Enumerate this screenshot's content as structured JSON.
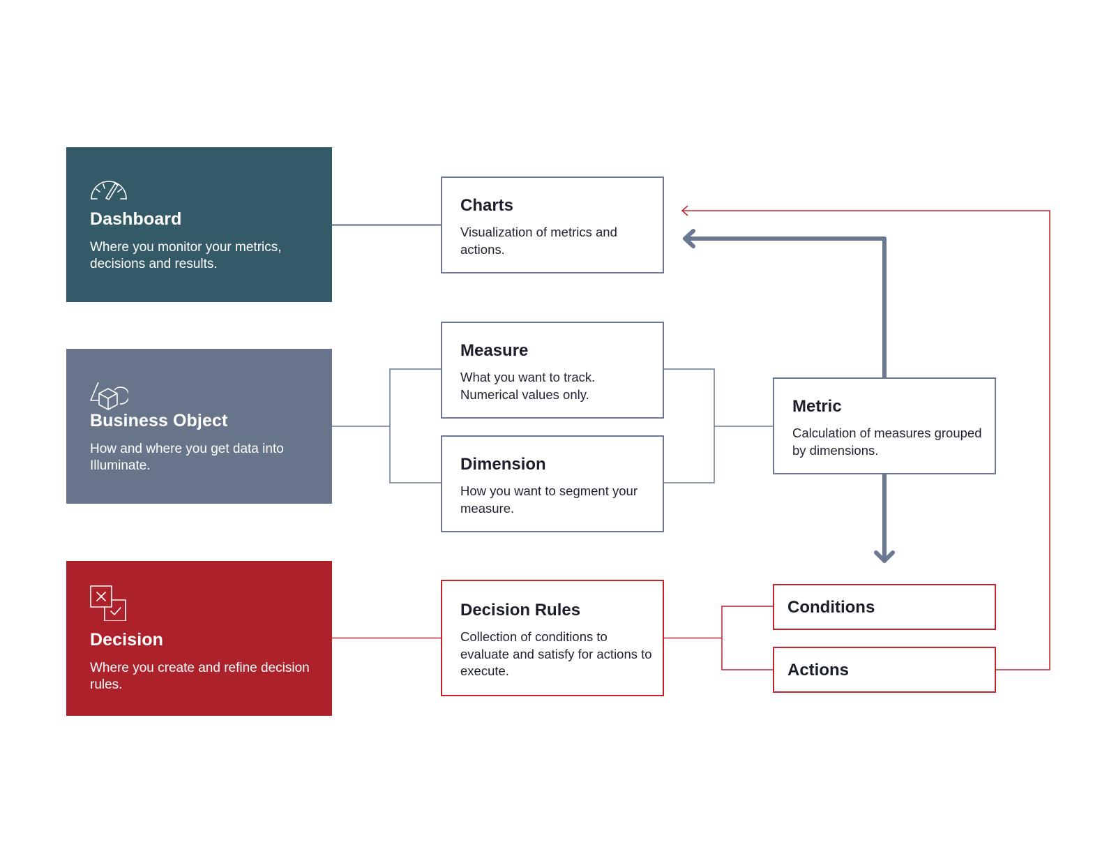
{
  "colors": {
    "dashboard": "#345a67",
    "business_object": "#687489",
    "decision": "#ad222a",
    "slate_line": "#6b7894",
    "red_line": "#c0202a",
    "dark_line": "#1f2a44"
  },
  "panels": {
    "dashboard": {
      "icon": "gauge-icon",
      "title": "Dashboard",
      "description": "Where you monitor your metrics, decisions and results."
    },
    "business_object": {
      "icon": "shapes-cube-icon",
      "title": "Business Object",
      "description": "How and where you get data into Illuminate."
    },
    "decision": {
      "icon": "decision-checkbox-icon",
      "title": "Decision",
      "description": "Where you create and refine decision rules."
    }
  },
  "boxes": {
    "charts": {
      "title": "Charts",
      "description": "Visualization of metrics and actions."
    },
    "measure": {
      "title": "Measure",
      "description": "What you want to track. Numerical values only."
    },
    "dimension": {
      "title": "Dimension",
      "description": "How you want to segment your measure."
    },
    "metric": {
      "title": "Metric",
      "description": "Calculation of measures grouped by dimensions."
    },
    "decision_rules": {
      "title": "Decision Rules",
      "description": "Collection of conditions to evaluate and satisfy for actions to execute."
    },
    "conditions": {
      "title": "Conditions"
    },
    "actions": {
      "title": "Actions"
    }
  },
  "connections": [
    {
      "from": "dashboard",
      "to": "charts",
      "style": "line"
    },
    {
      "from": "business_object",
      "to": [
        "measure",
        "dimension"
      ],
      "style": "bracket"
    },
    {
      "from": [
        "measure",
        "dimension"
      ],
      "to": "metric",
      "style": "bracket"
    },
    {
      "from": "metric",
      "to": "charts",
      "style": "thick-arrow"
    },
    {
      "from": "metric",
      "to": "conditions",
      "style": "thick-arrow"
    },
    {
      "from": "decision",
      "to": "decision_rules",
      "style": "red-line"
    },
    {
      "from": "decision_rules",
      "to": [
        "conditions",
        "actions"
      ],
      "style": "red-bracket"
    },
    {
      "from": "actions",
      "to": "charts",
      "style": "red-arrow"
    }
  ]
}
